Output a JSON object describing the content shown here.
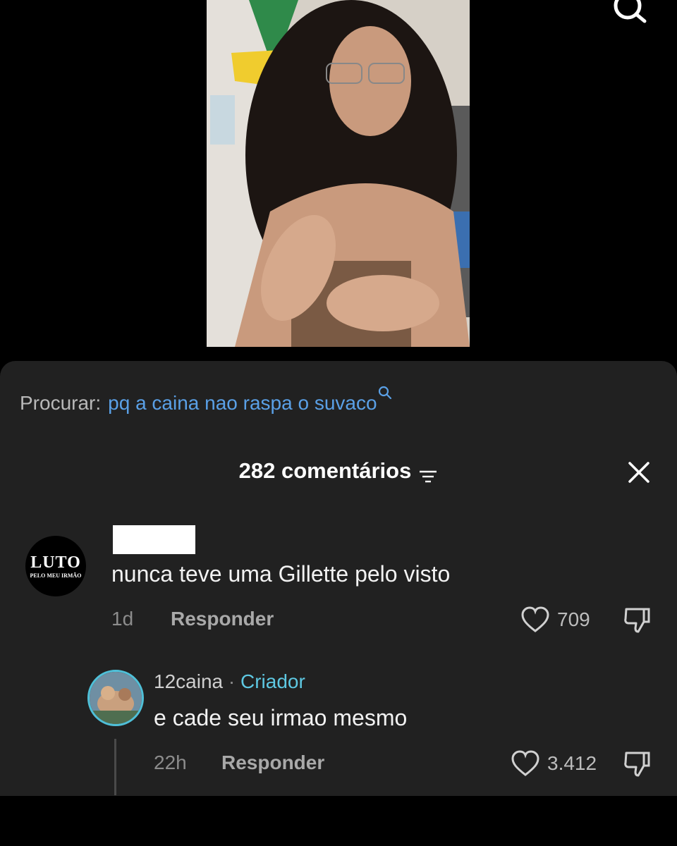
{
  "search_bar": {
    "label": "Procurar:",
    "query": "pq a caina nao raspa o suvaco"
  },
  "comments_header": {
    "title": "282 comentários"
  },
  "comments": [
    {
      "avatar_line1": "LUTO",
      "avatar_line2": "PELO MEU IRMÃO",
      "text": "nunca teve uma Gillette pelo visto",
      "time": "1d",
      "reply_label": "Responder",
      "likes": "709"
    },
    {
      "username": "12caina",
      "separator": "·",
      "badge": "Criador",
      "text": "e cade seu irmao mesmo",
      "time": "22h",
      "reply_label": "Responder",
      "likes": "3.412"
    }
  ],
  "colors": {
    "sheet_background": "#212121",
    "search_query": "#5aa0e6",
    "creator_badge": "#5ec8e2"
  }
}
